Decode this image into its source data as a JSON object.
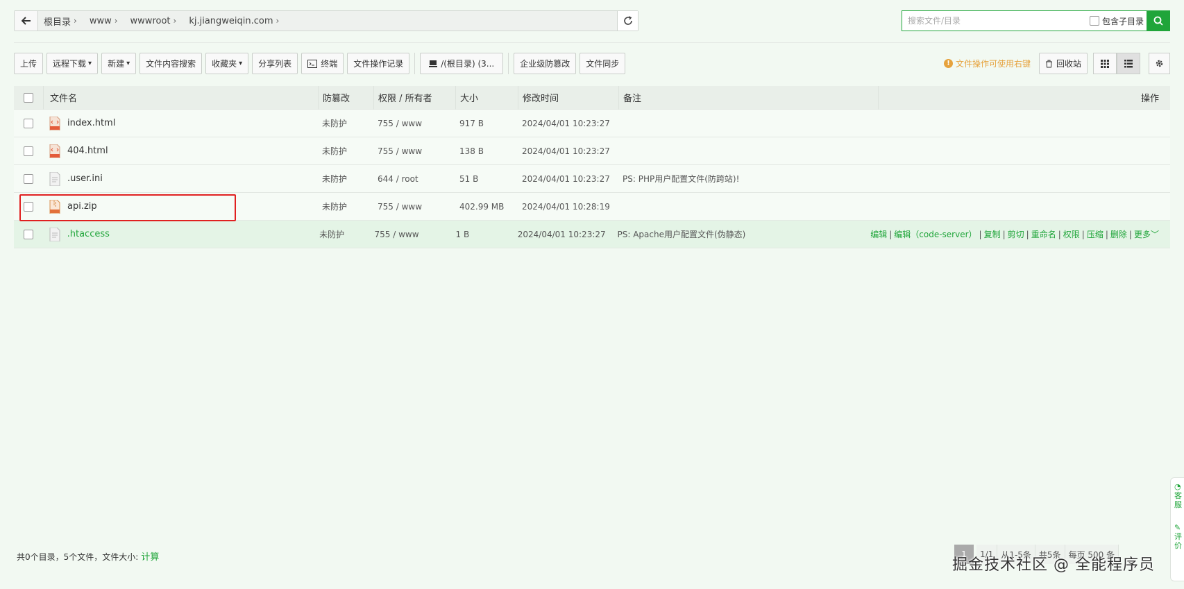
{
  "breadcrumb": {
    "items": [
      "根目录",
      "www",
      "wwwroot",
      "kj.jiangweiqin.com"
    ]
  },
  "search": {
    "placeholder": "搜索文件/目录",
    "include_subdirs_label": "包含子目录"
  },
  "toolbar": {
    "upload": "上传",
    "remote_download": "远程下载",
    "new": "新建",
    "content_search": "文件内容搜索",
    "favorites": "收藏夹",
    "share_list": "分享列表",
    "terminal": "终端",
    "operation_log": "文件操作记录",
    "disk": "/(根目录) (3...",
    "tamper_proof": "企业级防篡改",
    "file_sync": "文件同步"
  },
  "right_tools": {
    "hint": "文件操作可使用右键",
    "recycle_bin": "回收站"
  },
  "table": {
    "headers": {
      "name": "文件名",
      "protection": "防篡改",
      "permission": "权限 / 所有者",
      "size": "大小",
      "mtime": "修改时间",
      "note": "备注",
      "ops": "操作"
    },
    "rows": [
      {
        "name": "index.html",
        "icon": "html-file-icon",
        "protection": "未防护",
        "permission": "755 / www",
        "size": "917 B",
        "mtime": "2024/04/01 10:23:27",
        "note": ""
      },
      {
        "name": "404.html",
        "icon": "html-file-icon",
        "protection": "未防护",
        "permission": "755 / www",
        "size": "138 B",
        "mtime": "2024/04/01 10:23:27",
        "note": ""
      },
      {
        "name": ".user.ini",
        "icon": "text-file-icon",
        "protection": "未防护",
        "permission": "644 / root",
        "size": "51 B",
        "mtime": "2024/04/01 10:23:27",
        "note": "PS: PHP用户配置文件(防跨站)!"
      },
      {
        "name": "api.zip",
        "icon": "zip-file-icon",
        "protection": "未防护",
        "permission": "755 / www",
        "size": "402.99 MB",
        "mtime": "2024/04/01 10:28:19",
        "note": ""
      },
      {
        "name": ".htaccess",
        "icon": "text-file-icon",
        "protection": "未防护",
        "permission": "755 / www",
        "size": "1 B",
        "mtime": "2024/04/01 10:23:27",
        "note": "PS: Apache用户配置文件(伪静态)"
      }
    ],
    "row_ops": [
      "编辑",
      "编辑（code-server）",
      "复制",
      "剪切",
      "重命名",
      "权限",
      "压缩",
      "删除",
      "更多"
    ]
  },
  "footer": {
    "summary": "共0个目录，5个文件，文件大小:",
    "calc": "计算",
    "pager": {
      "current": "1",
      "page_info": "1/1",
      "range": "从1-5条",
      "total": "共5条",
      "per_page": "每页 500 条"
    }
  },
  "watermark": "掘金技术社区 @ 全能程序员",
  "side_float": {
    "first": "客服",
    "second": "评价"
  },
  "colors": {
    "accent": "#20a53a",
    "hint": "#e6a23c",
    "highlight_box": "#e02020",
    "background": "#f2f9f2"
  }
}
